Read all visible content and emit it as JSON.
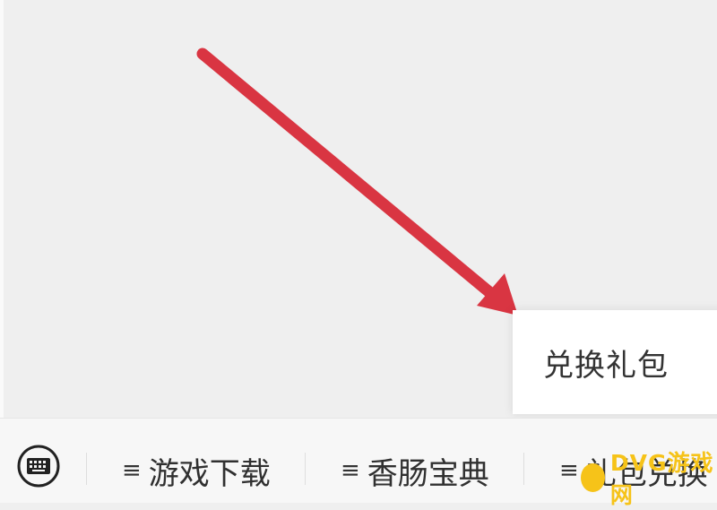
{
  "popup": {
    "item_label": "兑换礼包"
  },
  "bottom_bar": {
    "keyboard_icon": "keyboard-icon",
    "menus": [
      {
        "icon": "≡",
        "label": "游戏下载"
      },
      {
        "icon": "≡",
        "label": "香肠宝典"
      },
      {
        "icon": "≡",
        "label": "礼包兑换"
      }
    ]
  },
  "watermark": {
    "text": "DVG游戏网"
  },
  "colors": {
    "arrow": "#d93542",
    "background": "#efefef",
    "popup": "#ffffff",
    "bar": "#f7f7f7",
    "watermark": "#f6c319"
  }
}
